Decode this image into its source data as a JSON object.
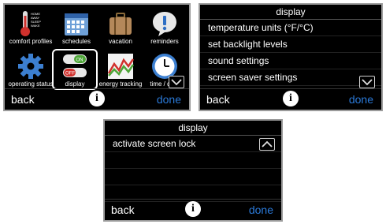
{
  "home": {
    "tiles": [
      {
        "label": "comfort profiles",
        "icon": "thermometer-icon"
      },
      {
        "label": "schedules",
        "icon": "calendar-icon"
      },
      {
        "label": "vacation",
        "icon": "suitcase-icon"
      },
      {
        "label": "reminders",
        "icon": "exclamation-icon"
      },
      {
        "label": "operating status",
        "icon": "gear-icon"
      },
      {
        "label": "display",
        "icon": "toggle-icon"
      },
      {
        "label": "energy tracking",
        "icon": "chart-icon"
      },
      {
        "label": "time / date",
        "icon": "clock-icon"
      }
    ],
    "thermometer_labels": [
      "HOME",
      "AWAY",
      "SLEEP",
      "WAKE"
    ],
    "toggle_labels": [
      "ON",
      "OFF"
    ],
    "footer": {
      "back": "back",
      "info": "i",
      "done": "done"
    }
  },
  "display_menu": {
    "title": "display",
    "items": [
      "temperature units (°F/°C)",
      "set backlight levels",
      "sound settings",
      "screen saver settings"
    ],
    "footer": {
      "back": "back",
      "info": "i",
      "done": "done"
    }
  },
  "lock_menu": {
    "title": "display",
    "items": [
      "activate screen lock"
    ],
    "footer": {
      "back": "back",
      "info": "i",
      "done": "done"
    }
  },
  "colors": {
    "done": "#2b7ad9",
    "screen_bg": "#000000",
    "bezel": "#9a9a9a"
  }
}
